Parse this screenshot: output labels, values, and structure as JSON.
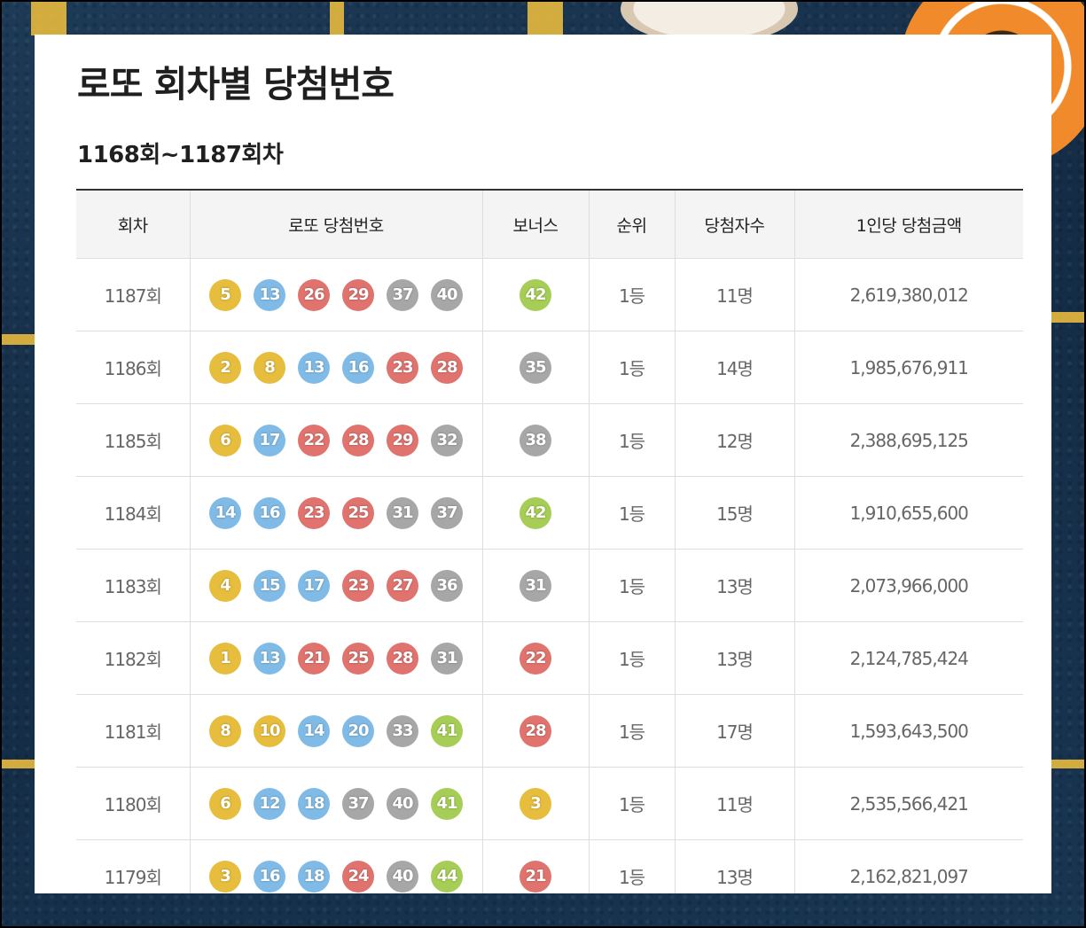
{
  "page": {
    "title": "로또 회차별 당첨번호",
    "subtitle": "1168회~1187회차"
  },
  "table": {
    "headers": [
      "회차",
      "로또 당첨번호",
      "보너스",
      "순위",
      "당첨자수",
      "1인당 당첨금액"
    ],
    "rows": [
      {
        "round": "1187회",
        "numbers": [
          "5",
          "13",
          "26",
          "29",
          "37",
          "40"
        ],
        "bonus": "42",
        "rank": "1등",
        "winners": "11명",
        "prize": "2,619,380,012"
      },
      {
        "round": "1186회",
        "numbers": [
          "2",
          "8",
          "13",
          "16",
          "23",
          "28"
        ],
        "bonus": "35",
        "rank": "1등",
        "winners": "14명",
        "prize": "1,985,676,911"
      },
      {
        "round": "1185회",
        "numbers": [
          "6",
          "17",
          "22",
          "28",
          "29",
          "32"
        ],
        "bonus": "38",
        "rank": "1등",
        "winners": "12명",
        "prize": "2,388,695,125"
      },
      {
        "round": "1184회",
        "numbers": [
          "14",
          "16",
          "23",
          "25",
          "31",
          "37"
        ],
        "bonus": "42",
        "rank": "1등",
        "winners": "15명",
        "prize": "1,910,655,600"
      },
      {
        "round": "1183회",
        "numbers": [
          "4",
          "15",
          "17",
          "23",
          "27",
          "36"
        ],
        "bonus": "31",
        "rank": "1등",
        "winners": "13명",
        "prize": "2,073,966,000"
      },
      {
        "round": "1182회",
        "numbers": [
          "1",
          "13",
          "21",
          "25",
          "28",
          "31"
        ],
        "bonus": "22",
        "rank": "1등",
        "winners": "13명",
        "prize": "2,124,785,424"
      },
      {
        "round": "1181회",
        "numbers": [
          "8",
          "10",
          "14",
          "20",
          "33",
          "41"
        ],
        "bonus": "28",
        "rank": "1등",
        "winners": "17명",
        "prize": "1,593,643,500"
      },
      {
        "round": "1180회",
        "numbers": [
          "6",
          "12",
          "18",
          "37",
          "40",
          "41"
        ],
        "bonus": "3",
        "rank": "1등",
        "winners": "11명",
        "prize": "2,535,566,421"
      },
      {
        "round": "1179회",
        "numbers": [
          "3",
          "16",
          "18",
          "24",
          "40",
          "44"
        ],
        "bonus": "21",
        "rank": "1등",
        "winners": "13명",
        "prize": "2,162,821,097"
      }
    ]
  },
  "ball_colors": {
    "1-10": "#e6bd3c",
    "11-20": "#7fbbe6",
    "21-30": "#e0736e",
    "31-40": "#a7a7a7",
    "41-45": "#a6cd55"
  },
  "colors": {
    "prize_text": "#a0492a",
    "header_bg": "#f4f4f4"
  }
}
